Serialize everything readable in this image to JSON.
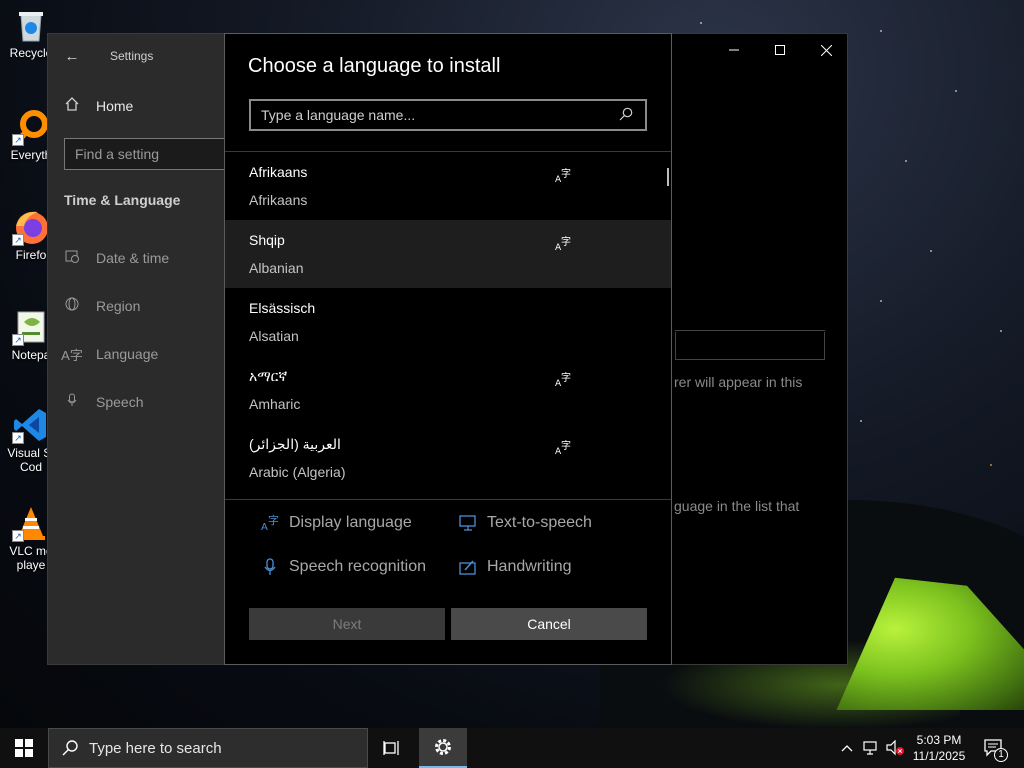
{
  "desktop": {
    "icons": [
      {
        "label": "Recycle",
        "icon": "recycle-bin-icon"
      },
      {
        "label": "Everyth",
        "icon": "everything-search-icon"
      },
      {
        "label": "Firefo",
        "icon": "firefox-icon"
      },
      {
        "label": "Notepa",
        "icon": "notepad-icon"
      },
      {
        "label": "Visual St",
        "label2": "Cod",
        "icon": "vscode-icon"
      },
      {
        "label": "VLC me",
        "label2": "playe",
        "icon": "vlc-icon"
      }
    ]
  },
  "settings": {
    "title": "Settings",
    "nav": {
      "home": "Home",
      "search_placeholder": "Find a setting",
      "section": "Time & Language",
      "items": [
        {
          "label": "Date & time",
          "icon": "calendar-clock-icon"
        },
        {
          "label": "Region",
          "icon": "globe-icon"
        },
        {
          "label": "Language",
          "icon": "language-icon"
        },
        {
          "label": "Speech",
          "icon": "microphone-icon"
        }
      ]
    },
    "background_text": {
      "a": "rer will appear in this",
      "b": "guage in the list that"
    }
  },
  "dialog": {
    "title": "Choose a language to install",
    "search_placeholder": "Type a language name...",
    "languages": [
      {
        "native": "Afrikaans",
        "english": "Afrikaans",
        "has_feature": true,
        "selected": false
      },
      {
        "native": "Shqip",
        "english": "Albanian",
        "has_feature": true,
        "selected": true
      },
      {
        "native": "Elsässisch",
        "english": "Alsatian",
        "has_feature": false,
        "selected": false
      },
      {
        "native": "አማርኛ",
        "english": "Amharic",
        "has_feature": true,
        "selected": false
      },
      {
        "native": "العربية (الجزائر)",
        "english": "Arabic (Algeria)",
        "has_feature": true,
        "selected": false
      }
    ],
    "features": {
      "display_language": "Display language",
      "text_to_speech": "Text-to-speech",
      "speech_recognition": "Speech recognition",
      "handwriting": "Handwriting"
    },
    "buttons": {
      "next": "Next",
      "cancel": "Cancel"
    }
  },
  "taskbar": {
    "search_placeholder": "Type here to search",
    "time": "5:03 PM",
    "date": "11/1/2025",
    "notification_count": "1"
  },
  "colors": {
    "accent": "#76b9ed",
    "feature_icon": "#4a8fd6",
    "tent_green": "#8fd12a"
  }
}
